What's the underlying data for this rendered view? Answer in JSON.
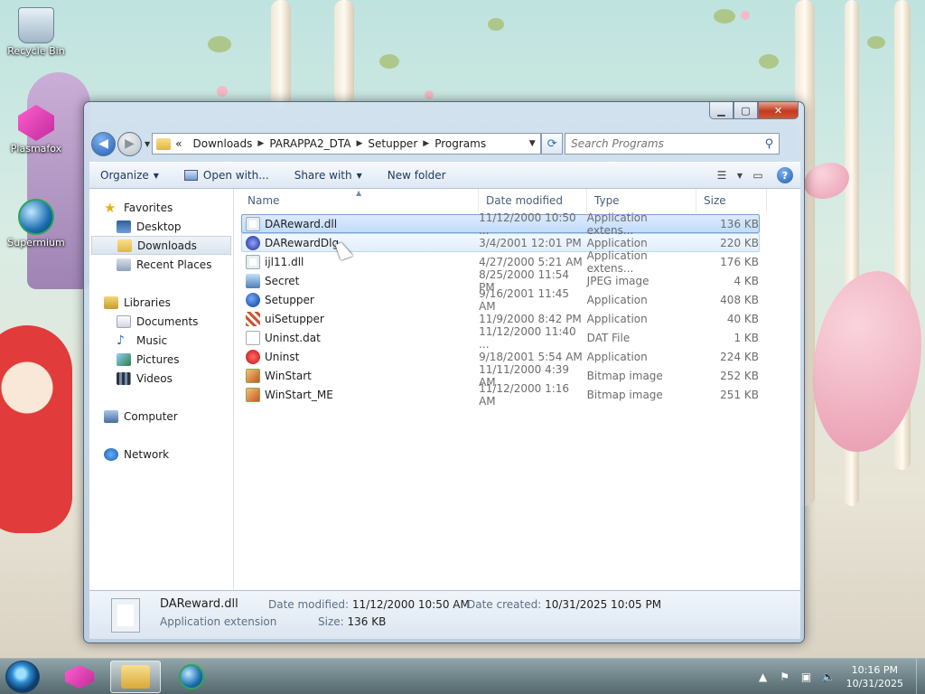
{
  "desktop": {
    "icons": [
      {
        "label": "Recycle Bin"
      },
      {
        "label": "Plasmafox"
      },
      {
        "label": "Supermium"
      }
    ]
  },
  "window": {
    "address": {
      "crumbs": [
        "Downloads",
        "PARAPPA2_DTA",
        "Setupper",
        "Programs"
      ],
      "prefix": "«"
    },
    "search": {
      "placeholder": "Search Programs"
    },
    "toolbar": {
      "organize": "Organize",
      "open_with": "Open with...",
      "share_with": "Share with",
      "new_folder": "New folder"
    },
    "nav": {
      "favorites": "Favorites",
      "desktop": "Desktop",
      "downloads": "Downloads",
      "recent": "Recent Places",
      "libraries": "Libraries",
      "documents": "Documents",
      "music": "Music",
      "pictures": "Pictures",
      "videos": "Videos",
      "computer": "Computer",
      "network": "Network"
    },
    "columns": {
      "name": "Name",
      "date": "Date modified",
      "type": "Type",
      "size": "Size"
    },
    "files": [
      {
        "name": "DAReward.dll",
        "date": "11/12/2000 10:50 ...",
        "type": "Application extens...",
        "size": "136 KB",
        "icon": "dll-icon"
      },
      {
        "name": "DARewardDlg",
        "date": "3/4/2001 12:01 PM",
        "type": "Application",
        "size": "220 KB",
        "icon": "app-icon"
      },
      {
        "name": "ijl11.dll",
        "date": "4/27/2000 5:21 AM",
        "type": "Application extens...",
        "size": "176 KB",
        "icon": "dll-icon"
      },
      {
        "name": "Secret",
        "date": "8/25/2000 11:54 PM",
        "type": "JPEG image",
        "size": "4 KB",
        "icon": "jpeg-icon"
      },
      {
        "name": "Setupper",
        "date": "9/16/2001 11:45 AM",
        "type": "Application",
        "size": "408 KB",
        "icon": "setup-icon"
      },
      {
        "name": "uiSetupper",
        "date": "11/9/2000 8:42 PM",
        "type": "Application",
        "size": "40 KB",
        "icon": "ui-icon"
      },
      {
        "name": "Uninst.dat",
        "date": "11/12/2000 11:40 ...",
        "type": "DAT File",
        "size": "1 KB",
        "icon": "dat-icon"
      },
      {
        "name": "Uninst",
        "date": "9/18/2001 5:54 AM",
        "type": "Application",
        "size": "224 KB",
        "icon": "uninst-icon"
      },
      {
        "name": "WinStart",
        "date": "11/11/2000 4:39 AM",
        "type": "Bitmap image",
        "size": "252 KB",
        "icon": "bitmap-icon"
      },
      {
        "name": "WinStart_ME",
        "date": "11/12/2000 1:16 AM",
        "type": "Bitmap image",
        "size": "251 KB",
        "icon": "bitmap-icon"
      }
    ],
    "details": {
      "name": "DAReward.dll",
      "kind": "Application extension",
      "modified_label": "Date modified:",
      "modified_value": "11/12/2000 10:50 AM",
      "created_label": "Date created:",
      "created_value": "10/31/2025 10:05 PM",
      "size_label": "Size:",
      "size_value": "136 KB"
    }
  },
  "taskbar": {
    "time": "10:16 PM",
    "date": "10/31/2025"
  }
}
